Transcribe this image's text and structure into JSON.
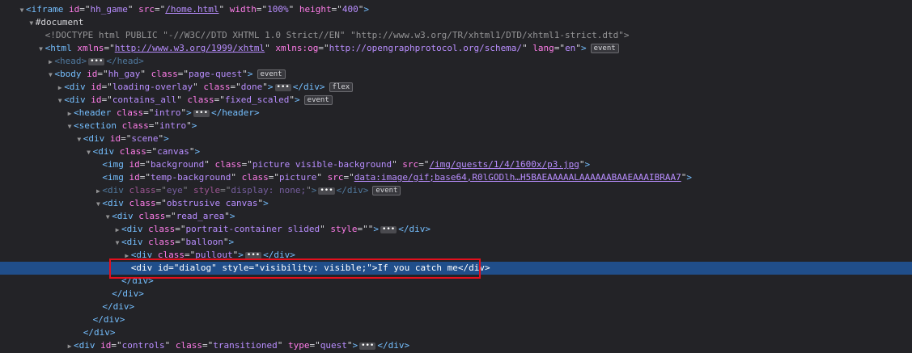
{
  "rows": [
    {
      "depth": 0,
      "twisty": "open",
      "segments": [
        {
          "t": "<",
          "c": "tag"
        },
        {
          "t": "iframe",
          "c": "tag"
        },
        {
          "t": " id",
          "c": "attr"
        },
        {
          "t": "=\"",
          "c": "pl"
        },
        {
          "t": "hh_game",
          "c": "val"
        },
        {
          "t": "\"",
          "c": "pl"
        },
        {
          "t": " src",
          "c": "attr"
        },
        {
          "t": "=\"",
          "c": "pl"
        },
        {
          "t": "/home.html",
          "c": "url"
        },
        {
          "t": "\"",
          "c": "pl"
        },
        {
          "t": " width",
          "c": "attr"
        },
        {
          "t": "=\"",
          "c": "pl"
        },
        {
          "t": "100%",
          "c": "val"
        },
        {
          "t": "\"",
          "c": "pl"
        },
        {
          "t": " height",
          "c": "attr"
        },
        {
          "t": "=\"",
          "c": "pl"
        },
        {
          "t": "400",
          "c": "val"
        },
        {
          "t": "\"",
          "c": "pl"
        },
        {
          "t": ">",
          "c": "tag"
        }
      ]
    },
    {
      "depth": 1,
      "twisty": "open",
      "segments": [
        {
          "t": "#document",
          "c": "pl"
        }
      ]
    },
    {
      "depth": 2,
      "twisty": "none",
      "segments": [
        {
          "t": "<!DOCTYPE html PUBLIC \"-//W3C//DTD XHTML 1.0 Strict//EN\" \"http://www.w3.org/TR/xhtml1/DTD/xhtml1-strict.dtd\">",
          "c": "doctype"
        }
      ]
    },
    {
      "depth": 2,
      "twisty": "open",
      "segments": [
        {
          "t": "<html",
          "c": "tag"
        },
        {
          "t": " xmlns",
          "c": "attr"
        },
        {
          "t": "=\"",
          "c": "pl"
        },
        {
          "t": "http://www.w3.org/1999/xhtml",
          "c": "url"
        },
        {
          "t": "\"",
          "c": "pl"
        },
        {
          "t": " xmlns:og",
          "c": "attr"
        },
        {
          "t": "=\"",
          "c": "pl"
        },
        {
          "t": "http://opengraphprotocol.org/schema/",
          "c": "val"
        },
        {
          "t": "\"",
          "c": "pl"
        },
        {
          "t": " lang",
          "c": "attr"
        },
        {
          "t": "=\"",
          "c": "pl"
        },
        {
          "t": "en",
          "c": "val"
        },
        {
          "t": "\"",
          "c": "pl"
        },
        {
          "t": ">",
          "c": "tag"
        }
      ],
      "badge": "event"
    },
    {
      "depth": 3,
      "twisty": "closed",
      "dim": true,
      "segments": [
        {
          "t": "<head>",
          "c": "tag"
        },
        {
          "t": "ELL",
          "c": "ell"
        },
        {
          "t": "</head>",
          "c": "tag"
        }
      ]
    },
    {
      "depth": 3,
      "twisty": "open",
      "segments": [
        {
          "t": "<body",
          "c": "tag"
        },
        {
          "t": " id",
          "c": "attr"
        },
        {
          "t": "=\"",
          "c": "pl"
        },
        {
          "t": "hh_gay",
          "c": "val"
        },
        {
          "t": "\"",
          "c": "pl"
        },
        {
          "t": " class",
          "c": "attr"
        },
        {
          "t": "=\"",
          "c": "pl"
        },
        {
          "t": "page-quest",
          "c": "val"
        },
        {
          "t": "\"",
          "c": "pl"
        },
        {
          "t": ">",
          "c": "tag"
        }
      ],
      "badge": "event"
    },
    {
      "depth": 4,
      "twisty": "closed",
      "segments": [
        {
          "t": "<div",
          "c": "tag"
        },
        {
          "t": " id",
          "c": "attr"
        },
        {
          "t": "=\"",
          "c": "pl"
        },
        {
          "t": "loading-overlay",
          "c": "val"
        },
        {
          "t": "\"",
          "c": "pl"
        },
        {
          "t": " class",
          "c": "attr"
        },
        {
          "t": "=\"",
          "c": "pl"
        },
        {
          "t": "done",
          "c": "val"
        },
        {
          "t": "\"",
          "c": "pl"
        },
        {
          "t": ">",
          "c": "tag"
        },
        {
          "t": "ELL",
          "c": "ell"
        },
        {
          "t": "</div>",
          "c": "tag"
        }
      ],
      "badge": "flex"
    },
    {
      "depth": 4,
      "twisty": "open",
      "segments": [
        {
          "t": "<div",
          "c": "tag"
        },
        {
          "t": " id",
          "c": "attr"
        },
        {
          "t": "=\"",
          "c": "pl"
        },
        {
          "t": "contains_all",
          "c": "val"
        },
        {
          "t": "\"",
          "c": "pl"
        },
        {
          "t": " class",
          "c": "attr"
        },
        {
          "t": "=\"",
          "c": "pl"
        },
        {
          "t": "fixed_scaled",
          "c": "val"
        },
        {
          "t": "\"",
          "c": "pl"
        },
        {
          "t": ">",
          "c": "tag"
        }
      ],
      "badge": "event"
    },
    {
      "depth": 5,
      "twisty": "closed",
      "segments": [
        {
          "t": "<header",
          "c": "tag"
        },
        {
          "t": " class",
          "c": "attr"
        },
        {
          "t": "=\"",
          "c": "pl"
        },
        {
          "t": "intro",
          "c": "val"
        },
        {
          "t": "\"",
          "c": "pl"
        },
        {
          "t": ">",
          "c": "tag"
        },
        {
          "t": "ELL",
          "c": "ell"
        },
        {
          "t": "</header>",
          "c": "tag"
        }
      ]
    },
    {
      "depth": 5,
      "twisty": "open",
      "segments": [
        {
          "t": "<section",
          "c": "tag"
        },
        {
          "t": " class",
          "c": "attr"
        },
        {
          "t": "=\"",
          "c": "pl"
        },
        {
          "t": "intro",
          "c": "val"
        },
        {
          "t": "\"",
          "c": "pl"
        },
        {
          "t": ">",
          "c": "tag"
        }
      ]
    },
    {
      "depth": 6,
      "twisty": "open",
      "segments": [
        {
          "t": "<div",
          "c": "tag"
        },
        {
          "t": " id",
          "c": "attr"
        },
        {
          "t": "=\"",
          "c": "pl"
        },
        {
          "t": "scene",
          "c": "val"
        },
        {
          "t": "\"",
          "c": "pl"
        },
        {
          "t": ">",
          "c": "tag"
        }
      ]
    },
    {
      "depth": 7,
      "twisty": "open",
      "segments": [
        {
          "t": "<div",
          "c": "tag"
        },
        {
          "t": " class",
          "c": "attr"
        },
        {
          "t": "=\"",
          "c": "pl"
        },
        {
          "t": "canvas",
          "c": "val"
        },
        {
          "t": "\"",
          "c": "pl"
        },
        {
          "t": ">",
          "c": "tag"
        }
      ]
    },
    {
      "depth": 8,
      "twisty": "none",
      "segments": [
        {
          "t": "<img",
          "c": "tag"
        },
        {
          "t": " id",
          "c": "attr"
        },
        {
          "t": "=\"",
          "c": "pl"
        },
        {
          "t": "background",
          "c": "val"
        },
        {
          "t": "\"",
          "c": "pl"
        },
        {
          "t": " class",
          "c": "attr"
        },
        {
          "t": "=\"",
          "c": "pl"
        },
        {
          "t": "picture visible-background",
          "c": "val"
        },
        {
          "t": "\"",
          "c": "pl"
        },
        {
          "t": " src",
          "c": "attr"
        },
        {
          "t": "=\"",
          "c": "pl"
        },
        {
          "t": "/img/quests/1/4/1600x/p3.jpg",
          "c": "url"
        },
        {
          "t": "\"",
          "c": "pl"
        },
        {
          "t": ">",
          "c": "tag"
        }
      ]
    },
    {
      "depth": 8,
      "twisty": "none",
      "segments": [
        {
          "t": "<img",
          "c": "tag"
        },
        {
          "t": " id",
          "c": "attr"
        },
        {
          "t": "=\"",
          "c": "pl"
        },
        {
          "t": "temp-background",
          "c": "val"
        },
        {
          "t": "\"",
          "c": "pl"
        },
        {
          "t": " class",
          "c": "attr"
        },
        {
          "t": "=\"",
          "c": "pl"
        },
        {
          "t": "picture",
          "c": "val"
        },
        {
          "t": "\"",
          "c": "pl"
        },
        {
          "t": " src",
          "c": "attr"
        },
        {
          "t": "=\"",
          "c": "pl"
        },
        {
          "t": "data:image/gif;base64,R0lGODlh…H5BAEAAAAALAAAAAABAAEAAAIBRAA7",
          "c": "url"
        },
        {
          "t": "\"",
          "c": "pl"
        },
        {
          "t": ">",
          "c": "tag"
        }
      ]
    },
    {
      "depth": 8,
      "twisty": "closed",
      "dim": true,
      "segments": [
        {
          "t": "<div",
          "c": "tag"
        },
        {
          "t": " class",
          "c": "attr"
        },
        {
          "t": "=\"",
          "c": "pl"
        },
        {
          "t": "eye",
          "c": "val"
        },
        {
          "t": "\"",
          "c": "pl"
        },
        {
          "t": " style",
          "c": "attr"
        },
        {
          "t": "=\"",
          "c": "pl"
        },
        {
          "t": "display: none;",
          "c": "val"
        },
        {
          "t": "\"",
          "c": "pl"
        },
        {
          "t": ">",
          "c": "tag"
        },
        {
          "t": "ELL",
          "c": "ell"
        },
        {
          "t": "</div>",
          "c": "tag"
        }
      ],
      "badge": "event"
    },
    {
      "depth": 8,
      "twisty": "open",
      "segments": [
        {
          "t": "<div",
          "c": "tag"
        },
        {
          "t": " class",
          "c": "attr"
        },
        {
          "t": "=\"",
          "c": "pl"
        },
        {
          "t": "obstrusive canvas",
          "c": "val"
        },
        {
          "t": "\"",
          "c": "pl"
        },
        {
          "t": ">",
          "c": "tag"
        }
      ]
    },
    {
      "depth": 9,
      "twisty": "open",
      "segments": [
        {
          "t": "<div",
          "c": "tag"
        },
        {
          "t": " class",
          "c": "attr"
        },
        {
          "t": "=\"",
          "c": "pl"
        },
        {
          "t": "read_area",
          "c": "val"
        },
        {
          "t": "\"",
          "c": "pl"
        },
        {
          "t": ">",
          "c": "tag"
        }
      ]
    },
    {
      "depth": 10,
      "twisty": "closed",
      "segments": [
        {
          "t": "<div",
          "c": "tag"
        },
        {
          "t": " class",
          "c": "attr"
        },
        {
          "t": "=\"",
          "c": "pl"
        },
        {
          "t": "portrait-container slided",
          "c": "val"
        },
        {
          "t": "\"",
          "c": "pl"
        },
        {
          "t": " style",
          "c": "attr"
        },
        {
          "t": "=\"\"",
          "c": "pl"
        },
        {
          "t": ">",
          "c": "tag"
        },
        {
          "t": "ELL",
          "c": "ell"
        },
        {
          "t": "</div>",
          "c": "tag"
        }
      ]
    },
    {
      "depth": 10,
      "twisty": "open",
      "segments": [
        {
          "t": "<div",
          "c": "tag"
        },
        {
          "t": " class",
          "c": "attr"
        },
        {
          "t": "=\"",
          "c": "pl"
        },
        {
          "t": "balloon",
          "c": "val"
        },
        {
          "t": "\"",
          "c": "pl"
        },
        {
          "t": ">",
          "c": "tag"
        }
      ]
    },
    {
      "depth": 11,
      "twisty": "closed",
      "segments": [
        {
          "t": "<div",
          "c": "tag"
        },
        {
          "t": " class",
          "c": "attr"
        },
        {
          "t": "=\"",
          "c": "pl"
        },
        {
          "t": "pullout",
          "c": "val"
        },
        {
          "t": "\"",
          "c": "pl"
        },
        {
          "t": ">",
          "c": "tag"
        },
        {
          "t": "ELL",
          "c": "ell"
        },
        {
          "t": "</div>",
          "c": "tag"
        }
      ]
    },
    {
      "depth": 11,
      "twisty": "none",
      "selected": true,
      "segments": [
        {
          "t": "<div",
          "c": "tag"
        },
        {
          "t": " id",
          "c": "attr"
        },
        {
          "t": "=\"",
          "c": "pl"
        },
        {
          "t": "dialog",
          "c": "val"
        },
        {
          "t": "\"",
          "c": "pl"
        },
        {
          "t": " style",
          "c": "attr"
        },
        {
          "t": "=\"",
          "c": "pl"
        },
        {
          "t": "visibility: visible;",
          "c": "val"
        },
        {
          "t": "\"",
          "c": "pl"
        },
        {
          "t": ">",
          "c": "tag"
        },
        {
          "t": "If you catch me",
          "c": "pl"
        },
        {
          "t": "</div>",
          "c": "tag"
        }
      ]
    },
    {
      "depth": 10,
      "twisty": "none",
      "segments": [
        {
          "t": "</div>",
          "c": "tag"
        }
      ]
    },
    {
      "depth": 9,
      "twisty": "none",
      "segments": [
        {
          "t": "</div>",
          "c": "tag"
        }
      ]
    },
    {
      "depth": 8,
      "twisty": "none",
      "segments": [
        {
          "t": "</div>",
          "c": "tag"
        }
      ]
    },
    {
      "depth": 7,
      "twisty": "none",
      "segments": [
        {
          "t": "</div>",
          "c": "tag"
        }
      ]
    },
    {
      "depth": 6,
      "twisty": "none",
      "segments": [
        {
          "t": "</div>",
          "c": "tag"
        }
      ]
    },
    {
      "depth": 5,
      "twisty": "closed",
      "segments": [
        {
          "t": "<div",
          "c": "tag"
        },
        {
          "t": " id",
          "c": "attr"
        },
        {
          "t": "=\"",
          "c": "pl"
        },
        {
          "t": "controls",
          "c": "val"
        },
        {
          "t": "\"",
          "c": "pl"
        },
        {
          "t": " class",
          "c": "attr"
        },
        {
          "t": "=\"",
          "c": "pl"
        },
        {
          "t": "transitioned",
          "c": "val"
        },
        {
          "t": "\"",
          "c": "pl"
        },
        {
          "t": " type",
          "c": "attr"
        },
        {
          "t": "=\"",
          "c": "pl"
        },
        {
          "t": "quest",
          "c": "val"
        },
        {
          "t": "\"",
          "c": "pl"
        },
        {
          "t": ">",
          "c": "tag"
        },
        {
          "t": "ELL",
          "c": "ell"
        },
        {
          "t": "</div>",
          "c": "tag"
        }
      ]
    }
  ],
  "ellipsis_glyph": "•••",
  "colors": {
    "background": "#232327",
    "selection": "#204e8a",
    "tag": "#75bfff",
    "attribute": "#ff7de9",
    "value": "#b98eff",
    "highlight_box": "#e3101e"
  }
}
